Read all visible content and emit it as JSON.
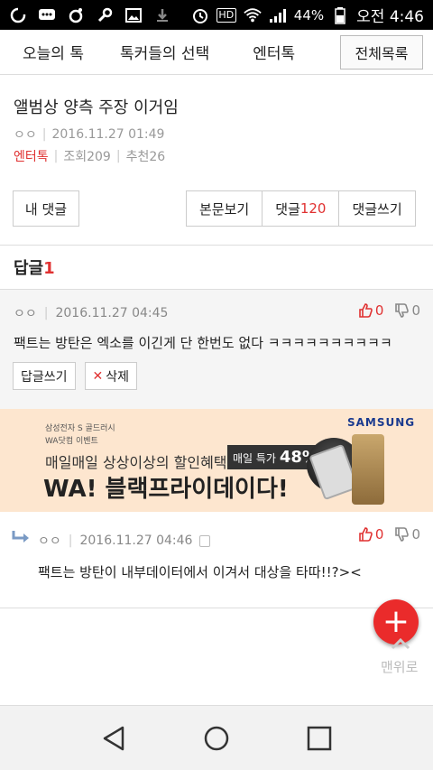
{
  "status_bar": {
    "battery": "44%",
    "time": "오전 4:46",
    "hd_label": "HD"
  },
  "nav": {
    "tabs": [
      "오늘의 톡",
      "톡커들의 선택",
      "엔터톡"
    ],
    "all_list": "전체목록"
  },
  "post": {
    "title": "앨범상 양측 주장 이거임",
    "author": "ㅇㅇ",
    "date": "2016.11.27 01:49",
    "category": "엔터톡",
    "views": "조회209",
    "recommend": "추천26"
  },
  "actions": {
    "my_comments": "내 댓글",
    "view_post": "본문보기",
    "comments_label": "댓글",
    "comments_count": "120",
    "write_comment": "댓글쓰기"
  },
  "replies_header": {
    "label": "답글",
    "count": "1"
  },
  "comment": {
    "author": "ㅇㅇ",
    "date": "2016.11.27 04:45",
    "up": "0",
    "down": "0",
    "text": "팩트는 방탄은 엑소를 이긴게 단 한번도 없다 ㅋㅋㅋㅋㅋㅋㅋㅋㅋㅋ",
    "reply_button": "답글쓰기",
    "delete_button": "삭제"
  },
  "ad": {
    "line_small1": "삼성전자 S 골드러시",
    "line_small2": "WA닷컴 이벤트",
    "line1": "매일매일 상상이상의 할인혜택",
    "line2": "WA! 블랙프라이데이다!",
    "badge_label": "매일 특가",
    "badge_pct": "48%~",
    "brand": "SAMSUNG"
  },
  "reply": {
    "author": "ㅇㅇ",
    "date": "2016.11.27 04:46",
    "up": "0",
    "down": "0",
    "text": "팩트는 방탄이 내부데이터에서 이겨서 대상을 타따!!?><"
  },
  "floating": {
    "plus": "+",
    "to_top": "맨위로"
  },
  "colors": {
    "accent": "#e03131",
    "fab": "#ea2b2b",
    "ad_bg": "#fde6cf"
  }
}
